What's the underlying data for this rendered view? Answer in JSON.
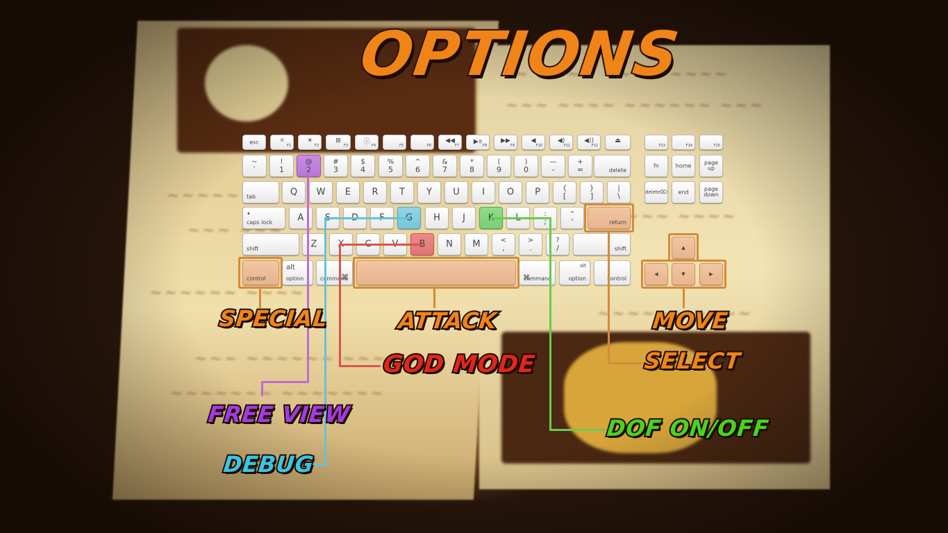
{
  "title": "OPTIONS",
  "colors": {
    "title": "#f08418",
    "special": "#f08418",
    "attack": "#f08418",
    "move": "#f08418",
    "select": "#f08418",
    "god_mode": "#e2261b",
    "free_view": "#a23be0",
    "debug": "#38c6e6",
    "dof": "#48d41e"
  },
  "labels": {
    "special": "SPECIAL",
    "attack": "ATTACK",
    "move": "MOVE",
    "god_mode": "GOD MODE",
    "select": "SELECT",
    "free_view": "FREE VIEW",
    "dof": "DOF ON/OFF",
    "debug": "DEBUG"
  },
  "keyboard": {
    "fn_row": {
      "esc": "esc",
      "f1": "F1",
      "f2": "F2",
      "f3": "F3",
      "f4": "F4",
      "f5": "F5",
      "f6": "F6",
      "f7": "F7",
      "f8": "F8",
      "f9": "F9",
      "f10": "F10",
      "f11": "F11",
      "f12": "F12",
      "f13": "F13",
      "f14": "F14",
      "f15": "F15",
      "icons": {
        "f1": "☼",
        "f2": "☀",
        "f3": "⊞",
        "f4": "ⓘ",
        "f7": "◀◀",
        "f8": "▶॥",
        "f9": "▶▶",
        "f10": "◀",
        "f11": "◀)",
        "f12": "◀))",
        "eject": "⏏"
      }
    },
    "number_row": [
      {
        "top": "~",
        "bot": "`"
      },
      {
        "top": "!",
        "bot": "1"
      },
      {
        "top": "@",
        "bot": "2"
      },
      {
        "top": "#",
        "bot": "3"
      },
      {
        "top": "$",
        "bot": "4"
      },
      {
        "top": "%",
        "bot": "5"
      },
      {
        "top": "^",
        "bot": "6"
      },
      {
        "top": "&",
        "bot": "7"
      },
      {
        "top": "*",
        "bot": "8"
      },
      {
        "top": "(",
        "bot": "9"
      },
      {
        "top": ")",
        "bot": "0"
      },
      {
        "top": "—",
        "bot": "-"
      },
      {
        "top": "+",
        "bot": "="
      }
    ],
    "delete": "delete",
    "tab": "tab",
    "qwerty": [
      "Q",
      "W",
      "E",
      "R",
      "T",
      "Y",
      "U",
      "I",
      "O",
      "P"
    ],
    "brackets": [
      {
        "top": "{",
        "bot": "["
      },
      {
        "top": "}",
        "bot": "]"
      },
      {
        "top": "|",
        "bot": "\\"
      }
    ],
    "caps_lock": "caps lock",
    "caps_dot": "•",
    "asdf": [
      "A",
      "S",
      "D",
      "F",
      "G",
      "H",
      "J",
      "K",
      "L"
    ],
    "semi": {
      "top": ":",
      "bot": ";"
    },
    "quote": {
      "top": "\"",
      "bot": "'"
    },
    "return": "return",
    "shift": "shift",
    "zxcv": [
      "Z",
      "X",
      "C",
      "V",
      "B",
      "N",
      "M"
    ],
    "comma": {
      "top": "<",
      "bot": ","
    },
    "period": {
      "top": ">",
      "bot": "."
    },
    "slash": {
      "top": "?",
      "bot": "/"
    },
    "control": "control",
    "alt": "alt",
    "option": "option",
    "command": "command",
    "cmd_symbol": "⌘",
    "nav": {
      "fn": "fn",
      "home": "home",
      "page_up": "page up",
      "delete_fwd": "delete",
      "delete_fwd_icon": "⌦",
      "end": "end",
      "page_down": "page down"
    },
    "arrows": {
      "up": "▲",
      "left": "◀",
      "down": "▼",
      "right": "▶"
    }
  }
}
